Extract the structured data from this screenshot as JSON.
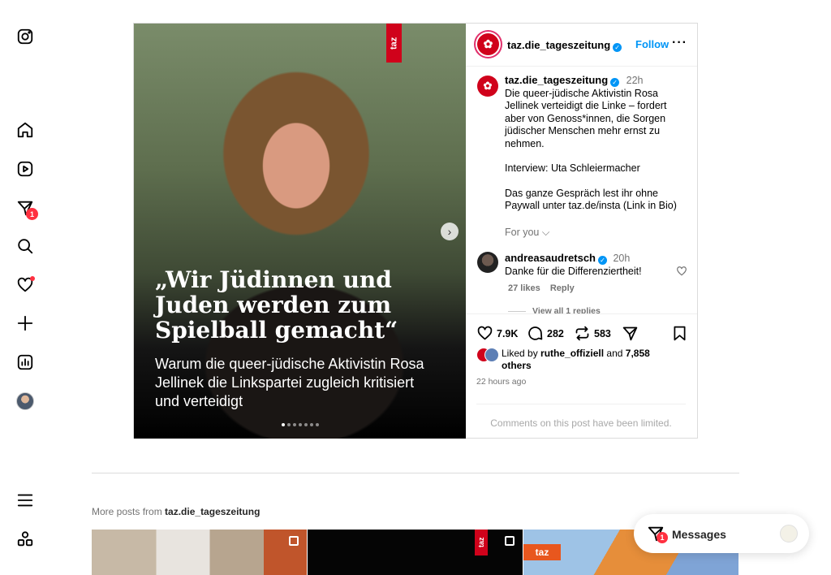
{
  "sidebar": {
    "items": [
      {
        "name": "instagram-logo-icon"
      },
      {
        "name": "home-icon"
      },
      {
        "name": "reels-icon"
      },
      {
        "name": "messages-icon",
        "badge": "1"
      },
      {
        "name": "search-icon"
      },
      {
        "name": "notifications-icon"
      },
      {
        "name": "create-icon"
      },
      {
        "name": "dashboard-icon"
      },
      {
        "name": "profile-avatar"
      },
      {
        "name": "menu-icon"
      },
      {
        "name": "also-from-meta-icon"
      }
    ]
  },
  "post": {
    "image": {
      "brand_tag": "taz",
      "headline": "„Wir Jüdinnen und Juden werden zum Spielball gemacht“",
      "subline": "Warum die queer-jüdische Aktivistin Rosa Jellinek die Linkspartei zugleich kritisiert und verteidigt",
      "slide_count": 7,
      "current_slide": 1
    },
    "header": {
      "username": "taz.die_tageszeitung",
      "follow_label": "Follow",
      "more_label": "···"
    },
    "caption": {
      "username": "taz.die_tageszeitung",
      "time": "22h",
      "para1": "Die queer-jüdische Aktivistin Rosa Jellinek verteidigt die Linke – fordert aber von Genoss*innen, die Sorgen jüdischer Menschen mehr ernst zu nehmen.",
      "para2": "Interview: Uta Schleiermacher",
      "para3": "Das ganze Gespräch lest ihr ohne Paywall unter taz.de/insta (Link in Bio)"
    },
    "for_you_label": "For you",
    "comment": {
      "username": "andreasaudretsch",
      "time": "20h",
      "text": "Danke für die Differenziertheit!",
      "likes": "27 likes",
      "reply_label": "Reply",
      "view_replies": "View all 1 replies"
    },
    "actions": {
      "likes": "7.9K",
      "comments": "282",
      "reposts": "583"
    },
    "liked_by": {
      "prefix": "Liked by",
      "user": "ruthe_offiziell",
      "conj": "and",
      "others": "7,858 others"
    },
    "timestamp": "22 hours ago",
    "comments_limited": "Comments on this post have been limited."
  },
  "more_posts": {
    "prefix": "More posts from",
    "username": "taz.die_tageszeitung",
    "thumb_tag_v": "taz",
    "thumb_tag_h": "taz"
  },
  "messages_bar": {
    "label": "Messages",
    "badge": "1"
  },
  "colors": {
    "accent": "#0095f6",
    "badge": "#ff3040",
    "taz_red": "#d0021b"
  }
}
